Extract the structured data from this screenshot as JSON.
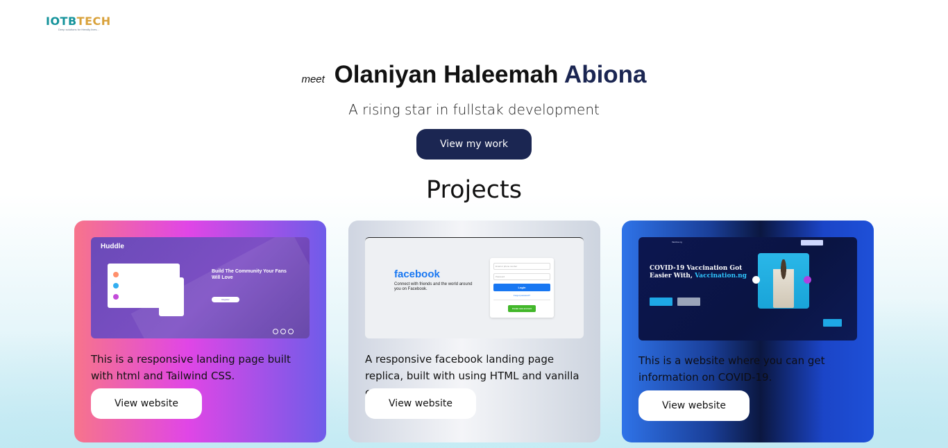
{
  "brand": {
    "logo_part1": "IOTB",
    "logo_part2": "TECH",
    "tagline": "Deep solutions for friendly lives..."
  },
  "hero": {
    "meet": "meet",
    "name_first": "Olaniyan Haleemah",
    "name_last": "Abiona",
    "subtitle": "A rising star in fullstak development",
    "cta_label": "View my work"
  },
  "projects": {
    "title": "Projects",
    "items": [
      {
        "description": "This is a responsive landing page built with html and Tailwind CSS.",
        "button_label": "View website",
        "preview": {
          "brand": "Huddle",
          "heading": "Build The Community Your Fans Will Love",
          "button": "Register"
        }
      },
      {
        "description": "A responsive facebook landing page replica, built with using HTML and vanilla css.",
        "button_label": "View website",
        "preview": {
          "brand": "facebook",
          "tagline": "Connect with friends and the world around you on Facebook.",
          "email_placeholder": "Email or phone number",
          "password_placeholder": "Password",
          "login": "Login",
          "forgot": "Forgot password?",
          "create": "Create new account"
        }
      },
      {
        "description": "This is a website where you can get information on COVID-19.",
        "button_label": "View website",
        "preview": {
          "brand": "Vaccine.ng",
          "headline": "COVID-19 Vaccination Got Easier With,",
          "headline_highlight": "Vaccination.ng"
        }
      }
    ]
  },
  "colors": {
    "primary": "#1b2652",
    "logo_teal": "#15939b",
    "logo_gold": "#d9a13a"
  }
}
